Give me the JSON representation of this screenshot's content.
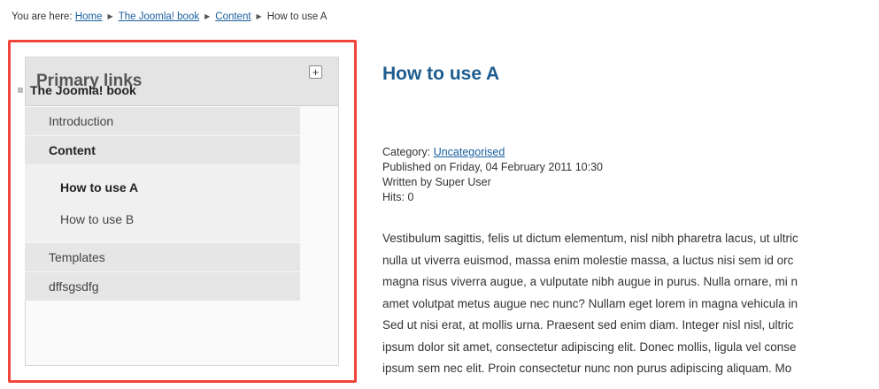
{
  "breadcrumb": {
    "prefix": "You are here:",
    "items": [
      "Home",
      "The Joomla! book",
      "Content"
    ],
    "current": "How to use A"
  },
  "module": {
    "title": "Primary links",
    "toggle_label": "+",
    "root_label": "The Joomla! book",
    "items": [
      {
        "label": "Introduction"
      },
      {
        "label": "Content"
      },
      {
        "label": "Templates"
      },
      {
        "label": "dffsgsdfg"
      }
    ],
    "subitems": [
      {
        "label": "How to use A"
      },
      {
        "label": "How to use B"
      }
    ]
  },
  "article": {
    "title": "How to use A",
    "category_label": "Category:",
    "category_link": "Uncategorised",
    "published": "Published on Friday, 04 February 2011 10:30",
    "written_by": "Written by Super User",
    "hits": "Hits: 0",
    "lines": [
      "Vestibulum sagittis, felis ut dictum elementum, nisl nibh pharetra lacus, ut ultric",
      "nulla ut viverra euismod, massa enim molestie massa, a luctus nisi sem id orc",
      "magna risus viverra augue, a vulputate nibh augue in purus. Nulla ornare, mi n",
      "amet volutpat metus augue nec nunc? Nullam eget lorem in magna vehicula in",
      "Sed ut nisi erat, at mollis urna. Praesent sed enim diam. Integer nisl nisl, ultric",
      "ipsum dolor sit amet, consectetur adipiscing elit. Donec mollis, ligula vel conse",
      "ipsum sem nec elit. Proin consectetur nunc non purus adipiscing aliquam. Mo"
    ]
  },
  "colors": {
    "link": "#1a5fa0",
    "title": "#1d5c8f",
    "highlight_border": "#f0453a"
  }
}
